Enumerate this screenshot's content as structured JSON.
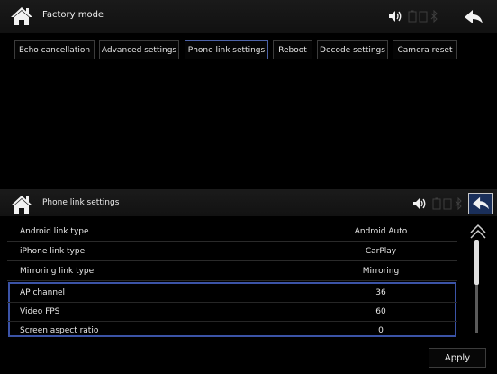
{
  "header": {
    "title": "Factory mode",
    "icons": [
      "home-icon",
      "volume-icon",
      "battery-icon",
      "bluetooth-icon",
      "back-icon"
    ]
  },
  "tabs": [
    {
      "label": "Echo cancellation"
    },
    {
      "label": "Advanced settings"
    },
    {
      "label": "Phone link settings",
      "active": true
    },
    {
      "label": "Reboot"
    },
    {
      "label": "Decode settings"
    },
    {
      "label": "Camera reset"
    }
  ],
  "subheader": {
    "title": "Phone link settings"
  },
  "settings": [
    {
      "label": "Android link type",
      "value": "Android Auto"
    },
    {
      "label": "iPhone link type",
      "value": "CarPlay"
    },
    {
      "label": "Mirroring link type",
      "value": "Mirroring"
    },
    {
      "label": "AP channel",
      "value": "36"
    },
    {
      "label": "Video FPS",
      "value": "60"
    },
    {
      "label": "Screen aspect ratio",
      "value": "0"
    }
  ],
  "apply_label": "Apply",
  "colors": {
    "accent": "#3b53a6",
    "background": "#000000",
    "text": "#e8e8e8"
  }
}
